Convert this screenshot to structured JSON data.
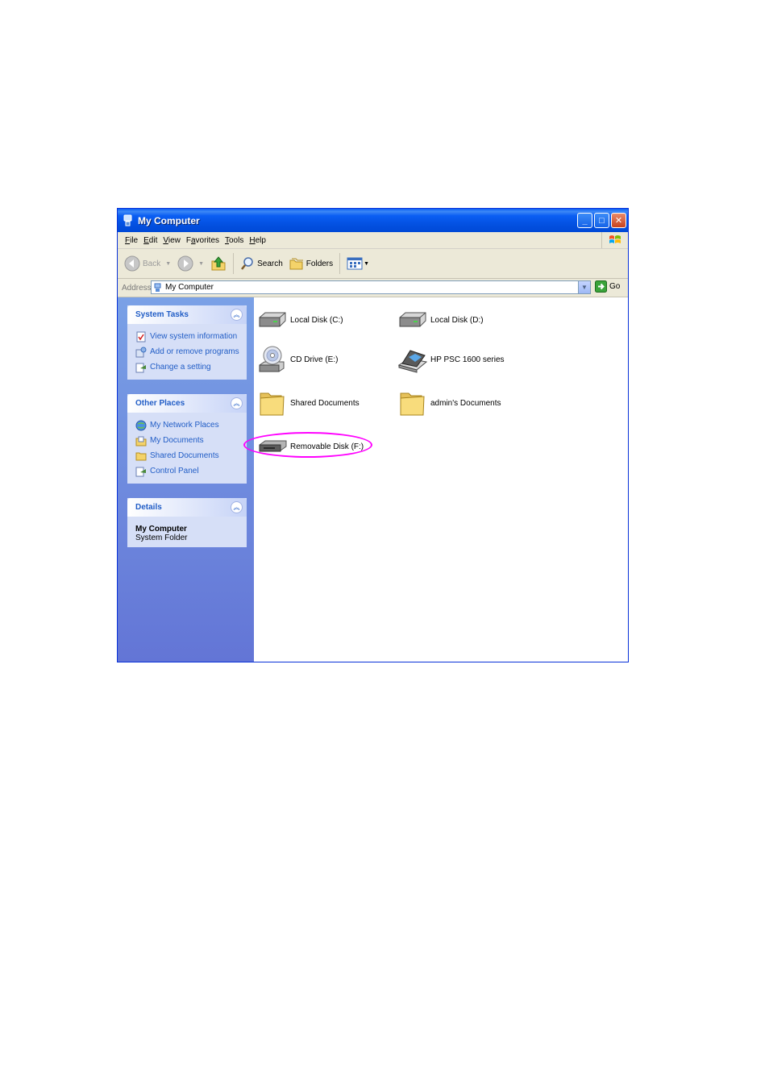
{
  "window": {
    "title": "My Computer",
    "buttons": {
      "minimize": "_",
      "maximize": "□",
      "close": "✕"
    }
  },
  "menu": {
    "items": [
      {
        "u": "F",
        "rest": "ile"
      },
      {
        "u": "E",
        "rest": "dit"
      },
      {
        "u": "V",
        "rest": "iew"
      },
      {
        "u": "",
        "pre": "F",
        "rest": "a",
        "post": "vorites"
      },
      {
        "u": "T",
        "rest": "ools"
      },
      {
        "u": "H",
        "rest": "elp"
      }
    ]
  },
  "toolbar": {
    "back": "Back",
    "search": "Search",
    "folders": "Folders"
  },
  "address": {
    "label": "Address",
    "value": "My Computer",
    "go": "Go"
  },
  "panels": {
    "system_tasks": {
      "title": "System Tasks",
      "items": [
        "View system information",
        "Add or remove programs",
        "Change a setting"
      ]
    },
    "other_places": {
      "title": "Other Places",
      "items": [
        "My Network Places",
        "My Documents",
        "Shared Documents",
        "Control Panel"
      ]
    },
    "details": {
      "title": "Details",
      "name": "My Computer",
      "type": "System Folder"
    }
  },
  "items": [
    {
      "label": "Local Disk (C:)",
      "icon": "hard-drive-icon"
    },
    {
      "label": "Local Disk (D:)",
      "icon": "hard-drive-icon"
    },
    {
      "label": "CD Drive (E:)",
      "icon": "cd-drive-icon"
    },
    {
      "label": "HP PSC 1600 series",
      "icon": "scanner-icon"
    },
    {
      "label": "Shared Documents",
      "icon": "folder-icon"
    },
    {
      "label": "admin's Documents",
      "icon": "folder-icon"
    },
    {
      "label": "Removable Disk (F:)",
      "icon": "removable-disk-icon"
    }
  ],
  "colors": {
    "titlebar": "#0a5ef3",
    "taskpane": "#6f8ee0",
    "link": "#215dc6",
    "highlight_ring": "#ff00ff"
  }
}
